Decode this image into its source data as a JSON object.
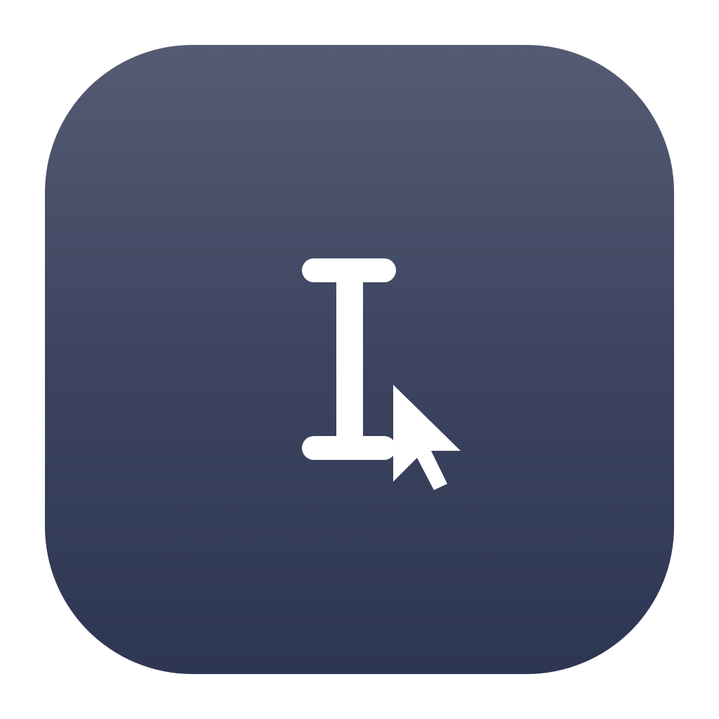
{
  "app_icon": {
    "name": "text-cursor-app-icon",
    "gradient_top": "#555b73",
    "gradient_bottom": "#2d3652",
    "glyph_color": "#ffffff",
    "icons": [
      "i-beam-cursor-icon",
      "arrow-pointer-icon"
    ]
  }
}
